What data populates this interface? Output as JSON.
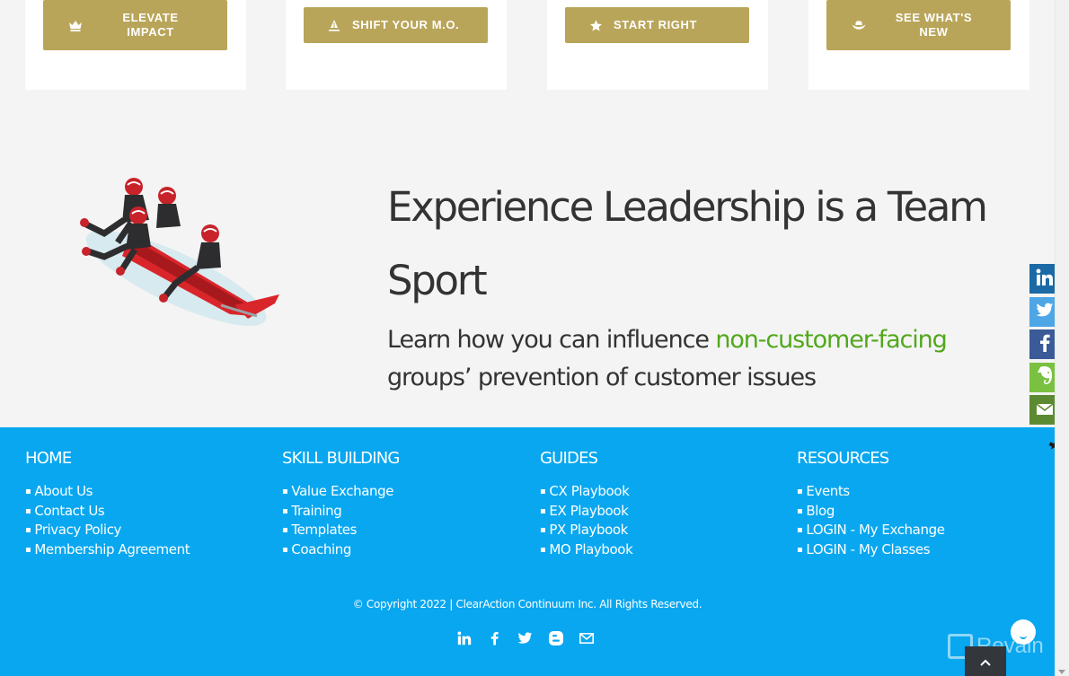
{
  "cards": [
    {
      "label": "ELEVATE IMPACT",
      "label_line1": "ELEVATE",
      "label_line2": "IMPACT",
      "icon": "crown-icon"
    },
    {
      "label": "SHIFT YOUR M.O.",
      "icon": "sailboat-icon"
    },
    {
      "label": "START RIGHT",
      "icon": "star-icon"
    },
    {
      "label": "SEE WHAT'S NEW",
      "label_line1": "SEE WHAT'S",
      "label_line2": "NEW",
      "icon": "cowboy-hat-icon"
    }
  ],
  "hero": {
    "image_alt": "bobsled team illustration",
    "title": "Experience Leadership is a Team Sport",
    "subtitle_pre": "Learn how you can influence ",
    "subtitle_highlight": "non-customer-facing",
    "subtitle_post": " groups’ prevention of customer issues",
    "highlight_color": "#51a81c"
  },
  "side_share": [
    {
      "name": "linkedin",
      "icon": "linkedin-icon"
    },
    {
      "name": "twitter",
      "icon": "twitter-icon"
    },
    {
      "name": "facebook",
      "icon": "facebook-icon"
    },
    {
      "name": "evernote",
      "icon": "evernote-icon"
    },
    {
      "name": "email",
      "icon": "email-icon"
    }
  ],
  "footer": {
    "background": "#08a7f0",
    "columns": [
      {
        "heading": "HOME",
        "links": [
          "About Us",
          "Contact Us",
          "Privacy Policy",
          "Membership Agreement"
        ]
      },
      {
        "heading": "SKILL BUILDING",
        "links": [
          "Value Exchange",
          "Training",
          "Templates",
          "Coaching"
        ]
      },
      {
        "heading": "GUIDES",
        "links": [
          "CX Playbook",
          "EX Playbook",
          "PX Playbook",
          "MO Playbook"
        ]
      },
      {
        "heading": "RESOURCES",
        "links": [
          "Events",
          "Blog",
          "LOGIN - My Exchange",
          "LOGIN - My Classes"
        ]
      }
    ],
    "bullet": "▪",
    "copyright": "© Copyright 2022 | ClearAction Continuum Inc. All Rights Reserved.",
    "social": [
      "linkedin-icon",
      "facebook-icon",
      "twitter-icon",
      "blogger-icon",
      "email-icon"
    ]
  },
  "watermark": "Revain",
  "colors": {
    "gold": "#b9a55a",
    "footer_blue": "#08a7f0",
    "text_dark": "#333333"
  }
}
